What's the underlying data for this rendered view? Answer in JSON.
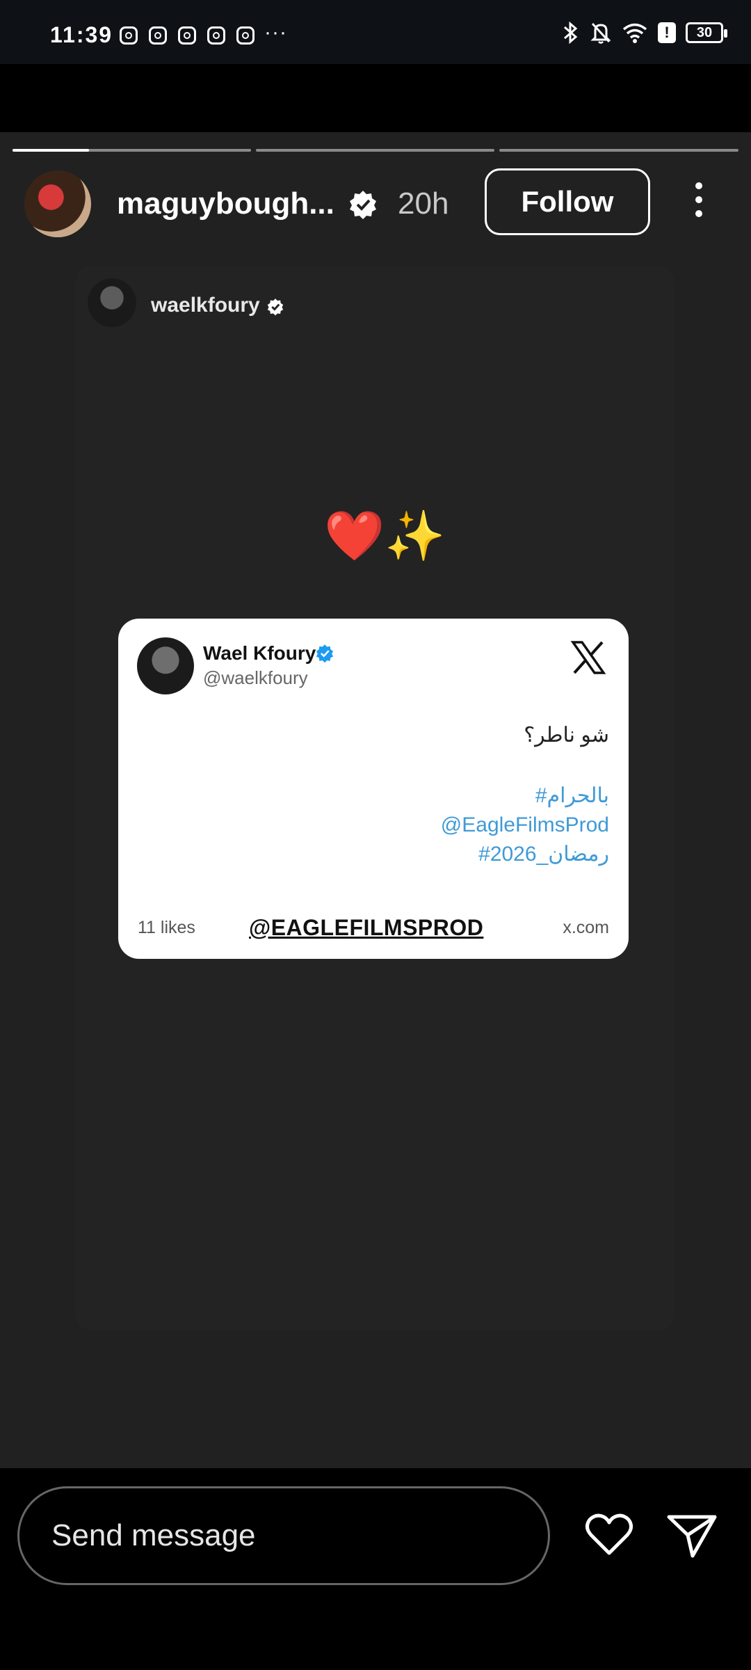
{
  "status_bar": {
    "time": "11:39",
    "more": "···",
    "battery": "30",
    "alert": "!"
  },
  "story": {
    "segments": [
      {
        "progress": 0.32
      },
      {
        "progress": 0
      },
      {
        "progress": 0
      }
    ],
    "author": {
      "username": "maguybough...",
      "time_ago": "20h",
      "follow_label": "Follow"
    },
    "repost": {
      "username": "waelkfoury"
    },
    "emoji": "❤️✨",
    "tweet": {
      "display_name": "Wael Kfoury",
      "handle": "@waelkfoury",
      "text": "شو ناطر؟",
      "tags": [
        "#بالحرام",
        "@EagleFilmsProd",
        "#رمضان_2026"
      ],
      "likes": "11 likes",
      "link_label": "@EAGLEFILMSPROD",
      "domain": "x.com"
    }
  },
  "bottom_bar": {
    "message_placeholder": "Send message"
  },
  "colors": {
    "story_background": "#212121",
    "link_blue": "#3f9ad6",
    "verified_blue": "#1d9bf0"
  }
}
